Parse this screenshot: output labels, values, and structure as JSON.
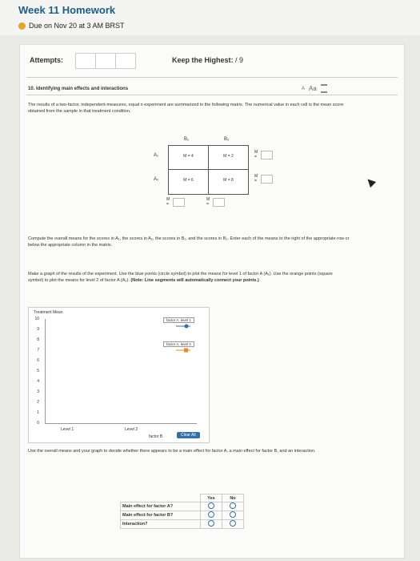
{
  "header": {
    "title": "Week 11 Homework",
    "due": "Due on Nov 20 at 3 AM BRST"
  },
  "attempts": {
    "label": "Attempts:",
    "keep_label": "Keep the Highest:",
    "keep_value": "/ 9"
  },
  "question": {
    "number_title": "10. Identifying main effects and interactions",
    "font_controls": [
      "A",
      "Aa"
    ],
    "intro": "The results of a two-factor, independent-measures, equal n experiment are summarized in the following matrix. The numerical value in each cell is the mean score obtained from the sample in that treatment condition."
  },
  "matrix": {
    "col_headers": [
      "B₁",
      "B₂"
    ],
    "row_headers": [
      "A₁",
      "A₂"
    ],
    "cells": [
      [
        "M = 4",
        "M = 2"
      ],
      [
        "M = 6",
        "M = 8"
      ]
    ],
    "m_label": "M ="
  },
  "compute_text": "Compute the overall means for the scores in A₁, the scores in A₂, the scores in B₁, and the scores in B₂. Enter each of the means to the right of the appropriate row or below the appropriate column in the matrix.",
  "graph_instructions": {
    "text": "Make a graph of the results of the experiment. Use the blue points (circle symbol) to plot the means for level 1 of factor A (A₁). Use the orange points (square symbol) to plot the means for level 2 of factor A (A₂).",
    "note": "(Note: Line segments will automatically connect your points.)"
  },
  "graph": {
    "y_title": "Treatment Mean",
    "y_ticks": [
      "10",
      "9",
      "8",
      "7",
      "6",
      "5",
      "4",
      "3",
      "2",
      "1",
      "0"
    ],
    "x_ticks": [
      "Level 1",
      "Level 2"
    ],
    "x_label": "factor B",
    "legend": [
      "factor A, level 1",
      "factor A, level 2"
    ],
    "colors": {
      "level1": "#3470a7",
      "level2": "#e8892e"
    },
    "clear_label": "Clear All"
  },
  "conclusion_text": "Use the overall means and your graph to decide whether there appears to be a main effect for factor A, a main effect for factor B, and an interaction.",
  "table": {
    "headers": [
      "Yes",
      "No"
    ],
    "rows": [
      "Main effect for factor A?",
      "Main effect for factor B?",
      "Interaction?"
    ]
  }
}
